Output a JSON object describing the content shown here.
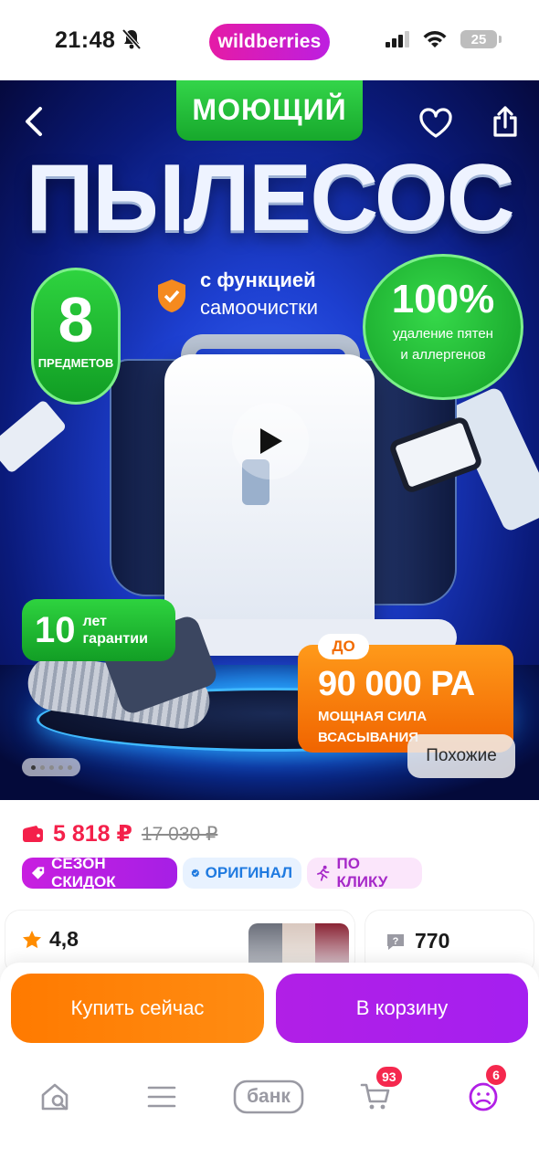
{
  "status_bar": {
    "time": "21:48",
    "brand": "wildberries",
    "battery": "25"
  },
  "hero": {
    "tag_top": "МОЮЩИЙ",
    "headline": "ПЫЛЕСОС",
    "badge_items": {
      "number": "8",
      "label": "ПРЕДМЕТОВ"
    },
    "feature": {
      "line1": "с функцией",
      "line2": "самоочистки"
    },
    "badge_clean": {
      "number": "100%",
      "line1": "удаление пятен",
      "line2": "и аллергенов"
    },
    "badge_warranty": {
      "number": "10",
      "line1": "лет",
      "line2": "гарантии"
    },
    "power": {
      "prefix": "ДО",
      "value": "90 000 РА",
      "line1": "МОЩНАЯ СИЛА",
      "line2": "ВСАСЫВАНИЯ"
    },
    "similar_label": "Похожие",
    "gallery": {
      "count": 5,
      "active": 1
    }
  },
  "price": {
    "current": "5 818 ₽",
    "old": "17 030 ₽"
  },
  "chips": {
    "season": "СЕЗОН СКИДОК",
    "original": "ОРИГИНАЛ",
    "click": "ПО КЛИКУ"
  },
  "rating": {
    "value": "4,8"
  },
  "questions": {
    "count": "770"
  },
  "actions": {
    "buy_now": "Купить сейчас",
    "add_to_cart": "В корзину"
  },
  "navbar": {
    "bank_label": "банк",
    "cart_badge": "93",
    "profile_badge": "6"
  },
  "colors": {
    "brand": "#cb11ab",
    "price": "#f4204a",
    "buy": "#ff7a00",
    "cart": "#a91fe8",
    "badge": "#f5284e"
  }
}
